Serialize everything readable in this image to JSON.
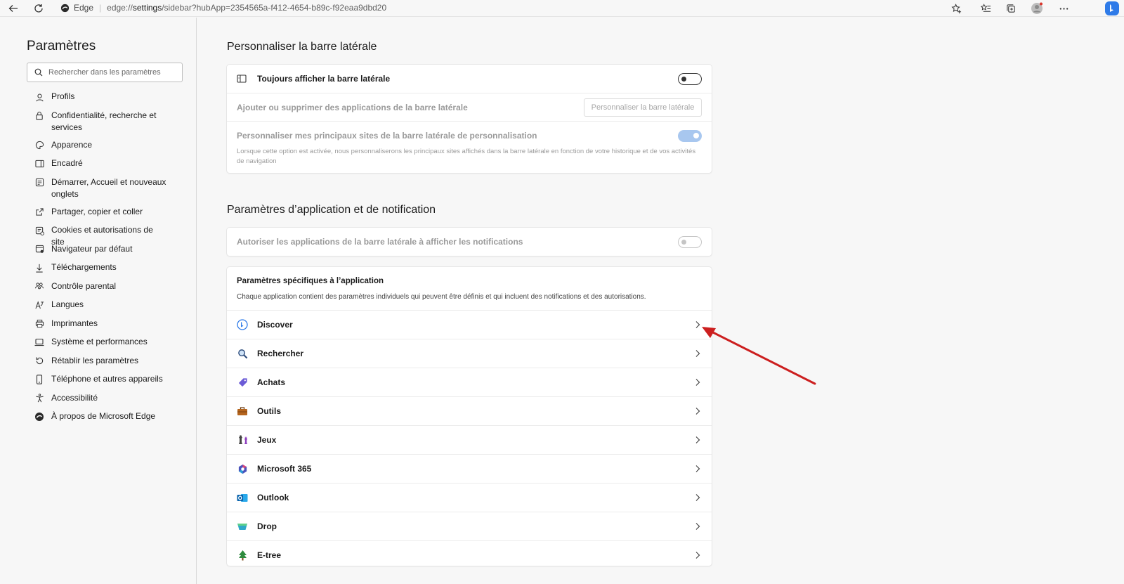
{
  "browser": {
    "brand": "Edge",
    "url_prefix": "edge://",
    "url_host": "settings",
    "url_rest": "/sidebar?hubApp=2354565a-f412-4654-b89c-f92eaa9dbd20"
  },
  "sidebar": {
    "title": "Paramètres",
    "search_placeholder": "Rechercher dans les paramètres",
    "items": [
      {
        "label": "Profils",
        "icon": "profile-icon"
      },
      {
        "label": "Confidentialité, recherche et services",
        "icon": "lock-icon"
      },
      {
        "label": "Apparence",
        "icon": "palette-icon"
      },
      {
        "label": "Encadré",
        "icon": "sidebar-panel-icon"
      },
      {
        "label": "Démarrer, Accueil et nouveaux onglets",
        "icon": "home-icon"
      },
      {
        "label": "Partager, copier et coller",
        "icon": "share-icon"
      },
      {
        "label": "Cookies et autorisations de site",
        "icon": "cookie-icon"
      },
      {
        "label": "Navigateur par défaut",
        "icon": "browser-icon"
      },
      {
        "label": "Téléchargements",
        "icon": "download-icon"
      },
      {
        "label": "Contrôle parental",
        "icon": "family-icon"
      },
      {
        "label": "Langues",
        "icon": "language-icon"
      },
      {
        "label": "Imprimantes",
        "icon": "printer-icon"
      },
      {
        "label": "Système et performances",
        "icon": "laptop-icon"
      },
      {
        "label": "Rétablir les paramètres",
        "icon": "reset-icon"
      },
      {
        "label": "Téléphone et autres appareils",
        "icon": "phone-icon"
      },
      {
        "label": "Accessibilité",
        "icon": "accessibility-icon"
      },
      {
        "label": "À propos de Microsoft Edge",
        "icon": "edge-logo-icon"
      }
    ]
  },
  "section1": {
    "title": "Personnaliser la barre latérale",
    "always_show_label": "Toujours afficher la barre latérale",
    "add_remove_label": "Ajouter ou supprimer des applications de la barre latérale",
    "customize_button": "Personnaliser la barre latérale",
    "personalize_label": "Personnaliser mes principaux sites de la barre latérale de personnalisation",
    "personalize_desc": "Lorsque cette option est activée, nous personnaliserons les principaux sites affichés dans la barre latérale en fonction de votre historique et de vos activités de navigation"
  },
  "section2": {
    "title": "Paramètres d’application et de notification",
    "notif_label": "Autoriser les applications de la barre latérale à afficher les notifications",
    "app_specific_title": "Paramètres spécifiques à l’application",
    "app_specific_desc": "Chaque application contient des paramètres individuels qui peuvent être définis et qui incluent des notifications et des autorisations.",
    "apps": [
      {
        "label": "Discover",
        "icon": "bing-discover-icon"
      },
      {
        "label": "Rechercher",
        "icon": "search-magnifier-icon"
      },
      {
        "label": "Achats",
        "icon": "shopping-tag-icon"
      },
      {
        "label": "Outils",
        "icon": "toolbox-icon"
      },
      {
        "label": "Jeux",
        "icon": "games-icon"
      },
      {
        "label": "Microsoft 365",
        "icon": "m365-icon"
      },
      {
        "label": "Outlook",
        "icon": "outlook-icon"
      },
      {
        "label": "Drop",
        "icon": "drop-icon"
      },
      {
        "label": "E-tree",
        "icon": "tree-icon"
      }
    ]
  },
  "colors": {
    "accent": "#0f6cbd",
    "annotation_arrow": "#cc1f1f"
  }
}
